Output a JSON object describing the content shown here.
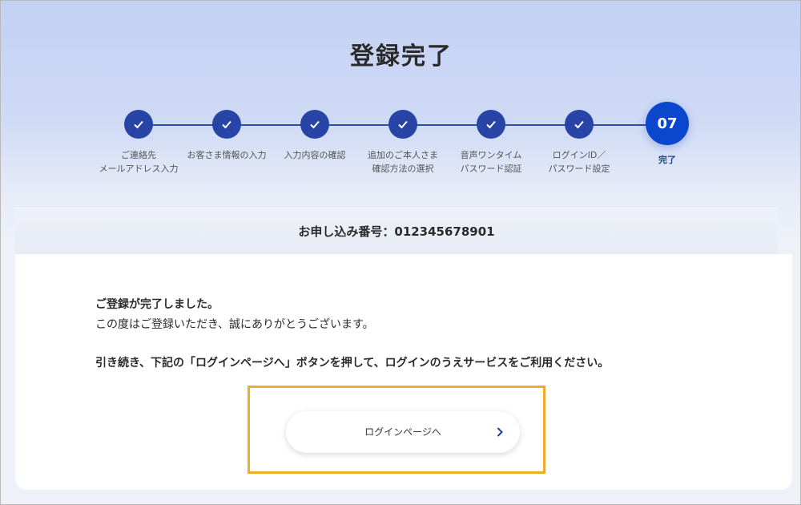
{
  "page": {
    "title": "登録完了"
  },
  "stepper": {
    "steps": [
      {
        "label_lines": [
          "ご連絡先",
          "メールアドレス入力"
        ],
        "status": "done"
      },
      {
        "label_lines": [
          "お客さま情報の入力"
        ],
        "status": "done"
      },
      {
        "label_lines": [
          "入力内容の確認"
        ],
        "status": "done"
      },
      {
        "label_lines": [
          "追加のご本人さま",
          "確認方法の選択"
        ],
        "status": "done"
      },
      {
        "label_lines": [
          "音声ワンタイム",
          "パスワード認証"
        ],
        "status": "done"
      },
      {
        "label_lines": [
          "ログインID／",
          "パスワード設定"
        ],
        "status": "done"
      },
      {
        "number": "07",
        "label_lines": [
          "完了"
        ],
        "status": "current"
      }
    ],
    "done_icon": "check-icon",
    "colors": {
      "done": "#2744a6",
      "current": "#0b47cc",
      "line": "#2b4ea8"
    }
  },
  "application": {
    "number_text": "お申し込み番号：012345678901"
  },
  "message": {
    "heading": "ご登録が完了しました。",
    "thanks": "この度はご登録いただき、誠にありがとうございます。",
    "instruction": "引き続き、下記の「ログインページへ」ボタンを押して、ログインのうえサービスをご利用ください。"
  },
  "login_button": {
    "label": "ログインページへ",
    "icon": "chevron-right-icon",
    "highlight_color": "#f0ac2a"
  }
}
